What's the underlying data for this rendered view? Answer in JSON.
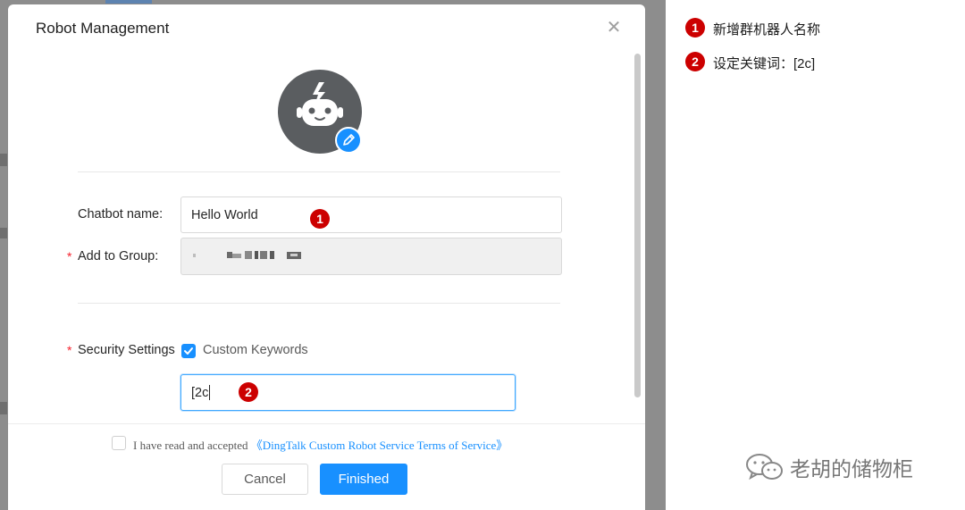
{
  "dialog": {
    "title": "Robot Management",
    "close_icon": "close-icon"
  },
  "avatar": {
    "icon": "robot-icon",
    "edit_icon": "pencil-icon"
  },
  "form": {
    "chatbot_name_label": "Chatbot name:",
    "chatbot_name_value": "Hello World",
    "add_to_group_label": "Add to Group:",
    "security_label": "Security Settings",
    "custom_keywords_label": "Custom Keywords",
    "custom_keywords_checked": true,
    "keyword_value": "[2c"
  },
  "footer": {
    "terms_prefix": "I have read and accepted",
    "terms_link": "《DingTalk Custom Robot Service Terms of Service》",
    "terms_checked": false,
    "cancel_label": "Cancel",
    "finish_label": "Finished"
  },
  "annotations": [
    {
      "number": "1",
      "text": "新增群机器人名称"
    },
    {
      "number": "2",
      "text": "设定关键词：[2c]"
    }
  ],
  "watermark": {
    "text": "老胡的储物柜",
    "icon": "wechat-icon"
  },
  "colors": {
    "primary": "#1890ff",
    "marker": "#cc0000",
    "backdrop": "#8d8d8d"
  }
}
